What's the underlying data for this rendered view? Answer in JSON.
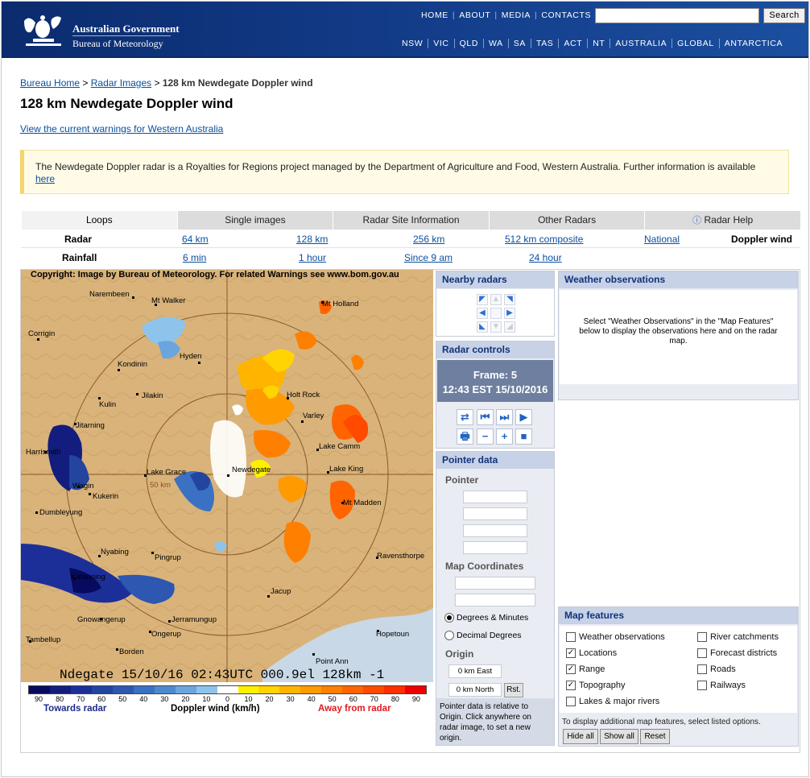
{
  "header": {
    "gov_title": "Australian Government",
    "bom_title": "Bureau of Meteorology",
    "topnav": [
      "HOME",
      "ABOUT",
      "MEDIA",
      "CONTACTS"
    ],
    "search_label": "Search",
    "states": [
      "NSW",
      "VIC",
      "QLD",
      "WA",
      "SA",
      "TAS",
      "ACT",
      "NT",
      "AUSTRALIA",
      "GLOBAL",
      "ANTARCTICA"
    ]
  },
  "breadcrumb": {
    "home": "Bureau Home",
    "radar": "Radar Images",
    "separator": ">",
    "current": "128 km Newdegate Doppler wind"
  },
  "page_title": "128 km Newdegate Doppler wind",
  "warnings_link": "View the current warnings for Western Australia",
  "notice": {
    "text": "The Newdegate Doppler radar is a Royalties for Regions project managed by the Department of Agriculture and Food, Western Australia. Further information is available",
    "link": "here"
  },
  "tabs": [
    "Loops",
    "Single images",
    "Radar Site Information",
    "Other Radars",
    "Radar Help"
  ],
  "rows": {
    "radar": {
      "label": "Radar",
      "items": [
        "64 km",
        "128 km",
        "256 km",
        "512 km composite",
        "National"
      ],
      "current": "Doppler wind"
    },
    "rainfall": {
      "label": "Rainfall",
      "items": [
        "6 min",
        "1 hour",
        "Since 9 am",
        "24 hour"
      ]
    }
  },
  "radar": {
    "copyright": "Copyright: Image by Bureau of Meteorology.  For related Warnings see www.bom.gov.au",
    "stamp": "Ndegate 15/10/16 02:43UTC 000.9el 128km -1",
    "ring_label": "50 km",
    "towns": [
      "Narembeen",
      "Mt Walker",
      "Mt Holland",
      "Corrigin",
      "Hyden",
      "Kondinin",
      "Kulin",
      "Jilakin",
      "Holt Rock",
      "Varley",
      "Jitarning",
      "Lake Camm",
      "Harrismith",
      "Lake Grace",
      "Newdegate",
      "Lake King",
      "Wagin",
      "Kukerin",
      "Mt Madden",
      "Dumbleyung",
      "Nyabing",
      "Pingrup",
      "Ravensthorpe",
      "Katanning",
      "Jacup",
      "Gnowangerup",
      "Jerramungup",
      "Ongerup",
      "Hopetoun",
      "Tambellup",
      "Borden",
      "Point Ann"
    ]
  },
  "legend": {
    "ticks": [
      "90",
      "80",
      "70",
      "60",
      "50",
      "40",
      "30",
      "20",
      "10",
      "0",
      "10",
      "20",
      "30",
      "40",
      "50",
      "60",
      "70",
      "80",
      "90"
    ],
    "colors": [
      "#070a5e",
      "#121d7e",
      "#1c2f99",
      "#23449f",
      "#2d57b0",
      "#3b71c2",
      "#4d89cf",
      "#6aa5dd",
      "#8ec4ec",
      "#ffffff",
      "#fff000",
      "#ffd400",
      "#ffb400",
      "#ff9a00",
      "#ff7f00",
      "#ff6400",
      "#ff4a00",
      "#ff2e00",
      "#ee0000"
    ],
    "towards": "Towards radar",
    "middle": "Doppler wind (km/h)",
    "away": "Away from radar"
  },
  "nearby": {
    "title": "Nearby radars"
  },
  "controls": {
    "title": "Radar controls",
    "frame": "Frame: 5",
    "time": "12:43 EST 15/10/2016"
  },
  "pointer": {
    "title": "Pointer data",
    "pointer_label": "Pointer",
    "map_coords_label": "Map Coordinates",
    "opt1": "Degrees & Minutes",
    "opt2": "Decimal Degrees",
    "origin_label": "Origin",
    "east": "0 km East",
    "north": "0 km North",
    "reset": "Rst.",
    "note": "Pointer data is relative to Origin. Click anywhere on radar image, to set a new origin."
  },
  "obs": {
    "title": "Weather observations",
    "text": "Select \"Weather Observations\" in the \"Map Features\" below to display the observations here and on the radar map."
  },
  "features": {
    "title": "Map features",
    "left": [
      {
        "label": "Weather observations",
        "checked": false
      },
      {
        "label": "Locations",
        "checked": true
      },
      {
        "label": "Range",
        "checked": true
      },
      {
        "label": "Topography",
        "checked": true
      },
      {
        "label": "Lakes & major rivers",
        "checked": false
      }
    ],
    "right": [
      {
        "label": "River catchments",
        "checked": false
      },
      {
        "label": "Forecast districts",
        "checked": false
      },
      {
        "label": "Roads",
        "checked": false
      },
      {
        "label": "Railways",
        "checked": false
      }
    ],
    "note": "To display additional map features, select listed options.",
    "hide_all": "Hide all",
    "show_all": "Show all",
    "reset": "Reset"
  }
}
